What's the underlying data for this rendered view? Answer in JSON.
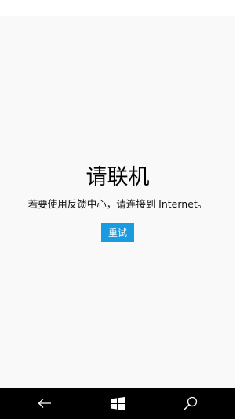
{
  "page": {
    "title": "请联机",
    "message": "若要使用反馈中心，请连接到 Internet。",
    "retry_label": "重试"
  },
  "nav_bar": {
    "back_icon": "back-arrow-icon",
    "start_icon": "windows-logo-icon",
    "search_icon": "search-icon"
  },
  "colors": {
    "accent": "#1a9be0",
    "background": "#f9f9f9",
    "nav_bar": "#000000"
  }
}
